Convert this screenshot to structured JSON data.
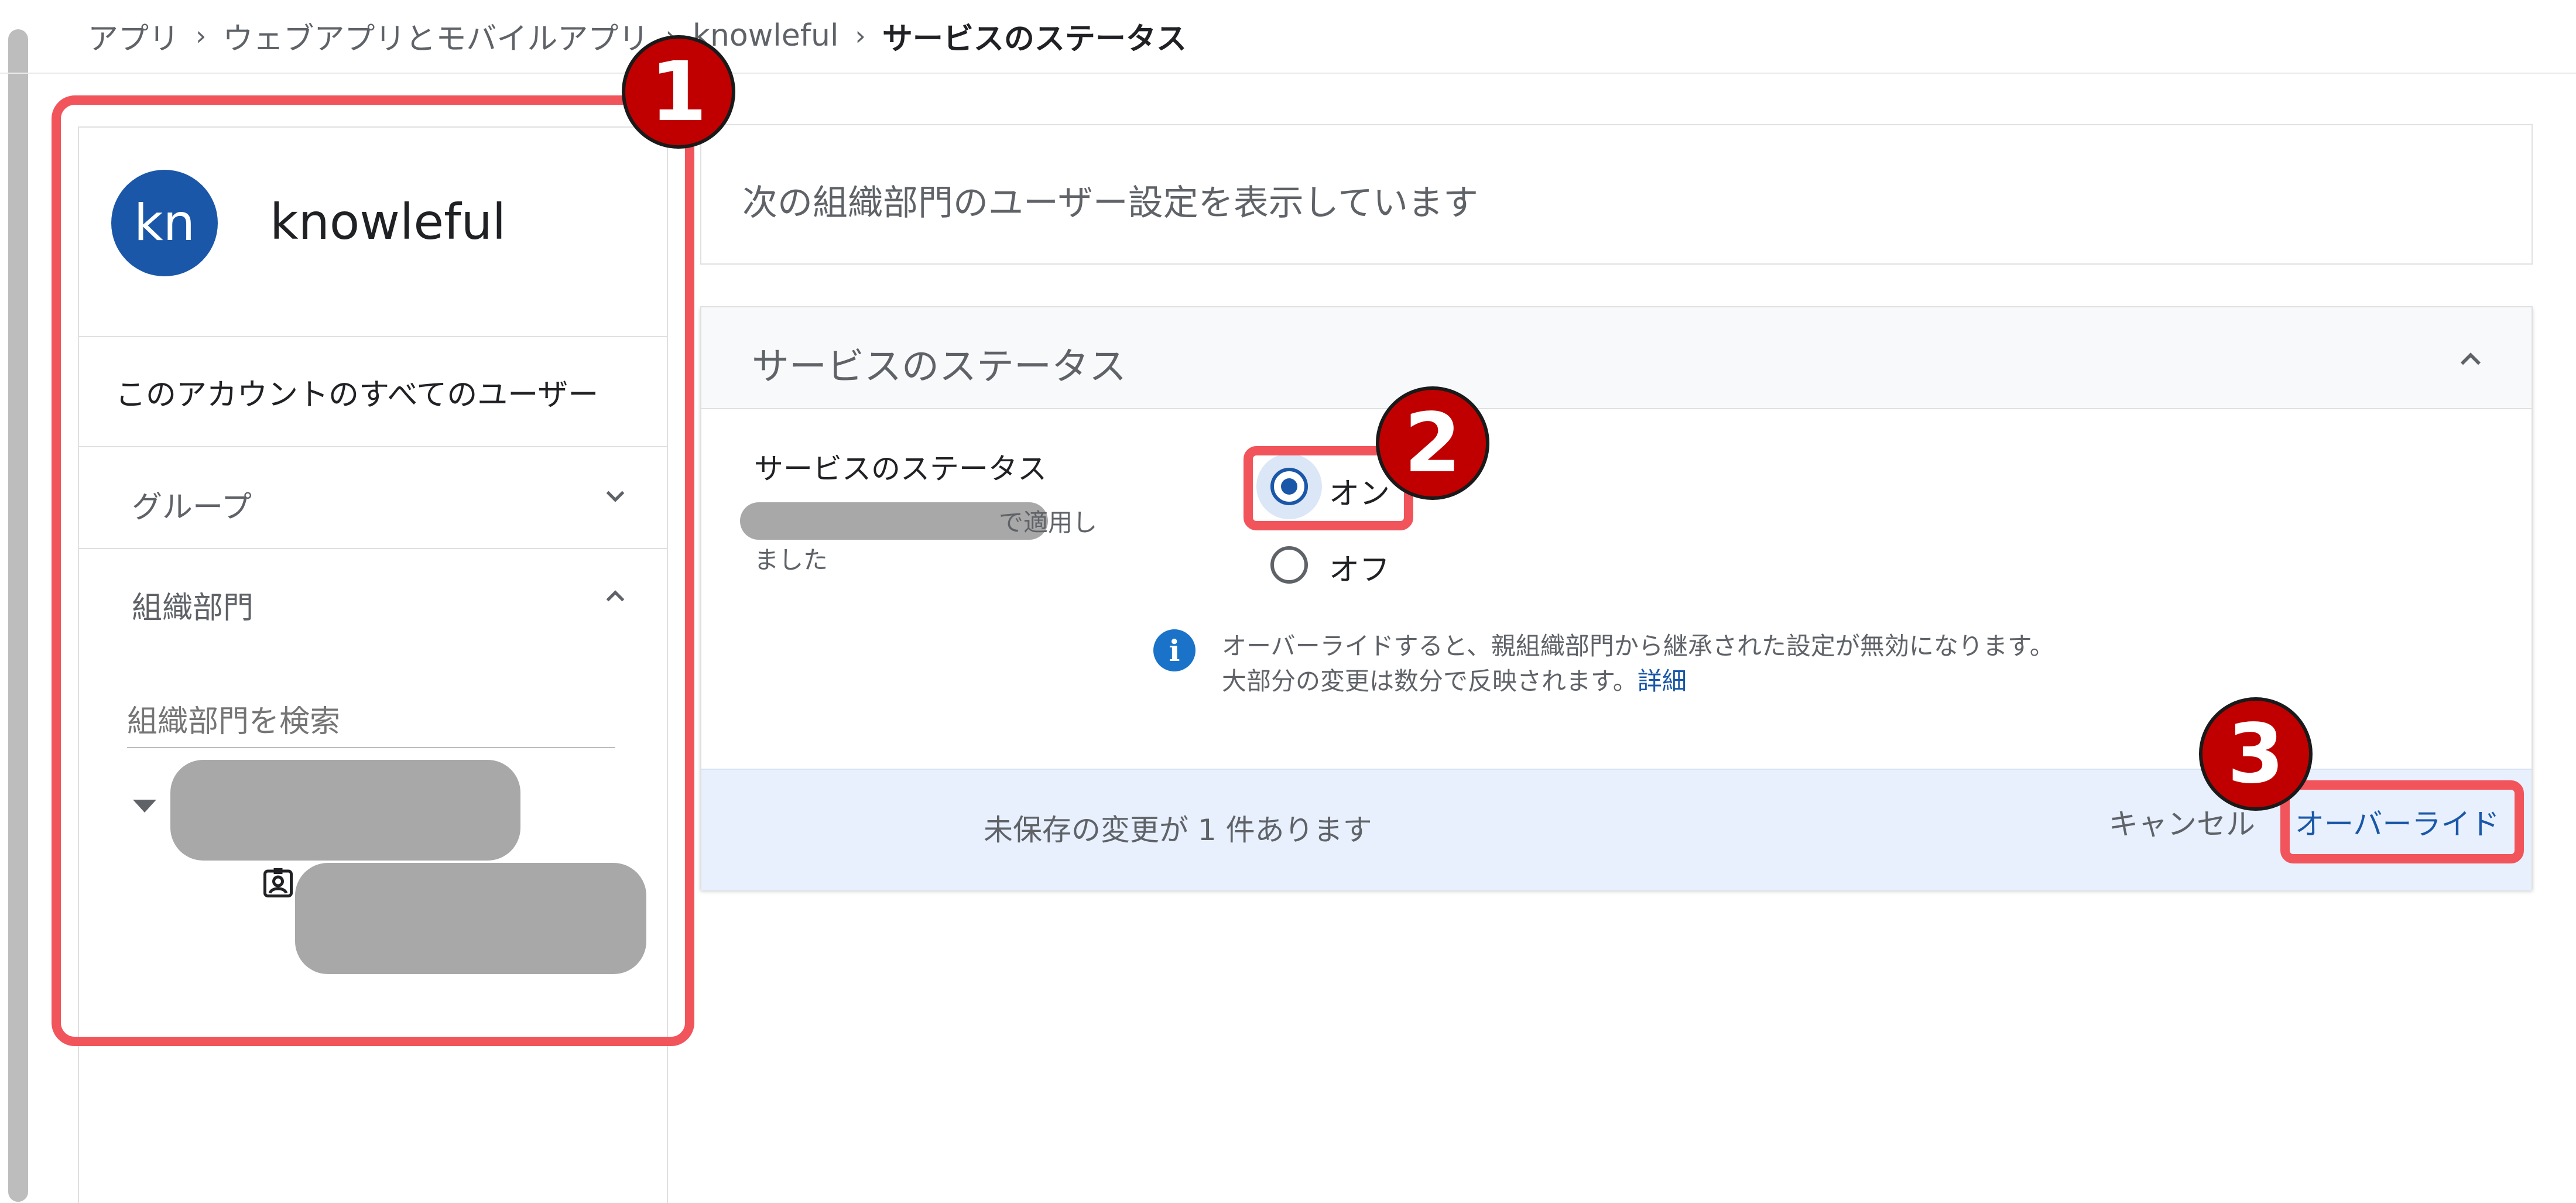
{
  "breadcrumb": {
    "items": [
      "アプリ",
      "ウェブアプリとモバイルアプリ",
      "knowleful"
    ],
    "current": "サービスのステータス"
  },
  "sidebar": {
    "avatar_initials": "kn",
    "org_name": "knowleful",
    "all_users": "このアカウントのすべてのユーザー",
    "groups_label": "グループ",
    "org_units_label": "組織部門",
    "search_placeholder": "組織部門を検索"
  },
  "main": {
    "info_banner": "次の組織部門のユーザー設定を表示しています",
    "section_title": "サービスのステータス",
    "setting_label": "サービスのステータス",
    "applied_text": "で適用し",
    "applied_text2": "ました",
    "options": {
      "on": "オン",
      "off": "オフ"
    },
    "selected_option": "on",
    "info_line1": "オーバーライドすると、親組織部門から継承された設定が無効になります。",
    "info_line2": "大部分の変更は数分で反映されます。",
    "info_link": "詳細"
  },
  "footer": {
    "unsaved": "未保存の変更が 1 件あります",
    "cancel": "キャンセル",
    "override": "オーバーライド"
  },
  "annotations": {
    "badge1": "1",
    "badge2": "2",
    "badge3": "3"
  },
  "colors": {
    "annotation": "#f2545b",
    "badge": "#c00000",
    "primary": "#1a57a8",
    "footer_bg": "#e8f0fe"
  }
}
